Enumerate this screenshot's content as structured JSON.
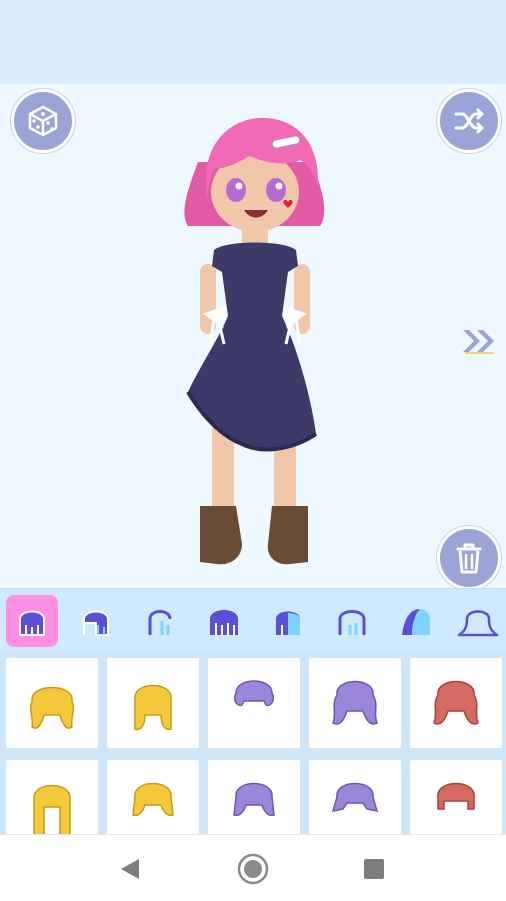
{
  "app": {
    "screen": "character-dress-up",
    "colors": {
      "accent": "#9aa4d6",
      "tab_active": "#ff8fe4",
      "hair_blonde": "#f3c93b",
      "hair_purple": "#9b86d9",
      "hair_red": "#d56a62",
      "dress": "#3d3a6a",
      "skin": "#f0c7a8",
      "hair_pink": "#f06ab6"
    }
  },
  "toolbar": {
    "randomize_icon": "dice-icon",
    "shuffle_icon": "shuffle-icon",
    "delete_icon": "trash-icon",
    "next_icon": "double-chevron-right-icon"
  },
  "tabs": [
    {
      "icon": "hair-front-icon",
      "active": true
    },
    {
      "icon": "hair-side-icon",
      "active": false
    },
    {
      "icon": "hair-profile-icon",
      "active": false
    },
    {
      "icon": "bangs-icon",
      "active": false
    },
    {
      "icon": "bangs-side-icon",
      "active": false
    },
    {
      "icon": "hair-back-icon",
      "active": false
    },
    {
      "icon": "hair-half-icon",
      "active": false
    },
    {
      "icon": "hair-outline-icon",
      "active": false
    }
  ],
  "hair_options": [
    {
      "color": "blonde",
      "style": "wavy-long"
    },
    {
      "color": "blonde",
      "style": "straight-long"
    },
    {
      "color": "purple",
      "style": "wavy-short"
    },
    {
      "color": "purple",
      "style": "curly-long"
    },
    {
      "color": "red",
      "style": "curly-long"
    },
    {
      "color": "blonde",
      "style": "bangs-long"
    },
    {
      "color": "blonde",
      "style": "bob"
    },
    {
      "color": "purple",
      "style": "bob"
    },
    {
      "color": "purple",
      "style": "flip"
    },
    {
      "color": "red",
      "style": "blunt-bob"
    }
  ],
  "navigation": {
    "back_icon": "back-triangle-icon",
    "home_icon": "home-circle-icon",
    "recents_icon": "recents-square-icon"
  }
}
